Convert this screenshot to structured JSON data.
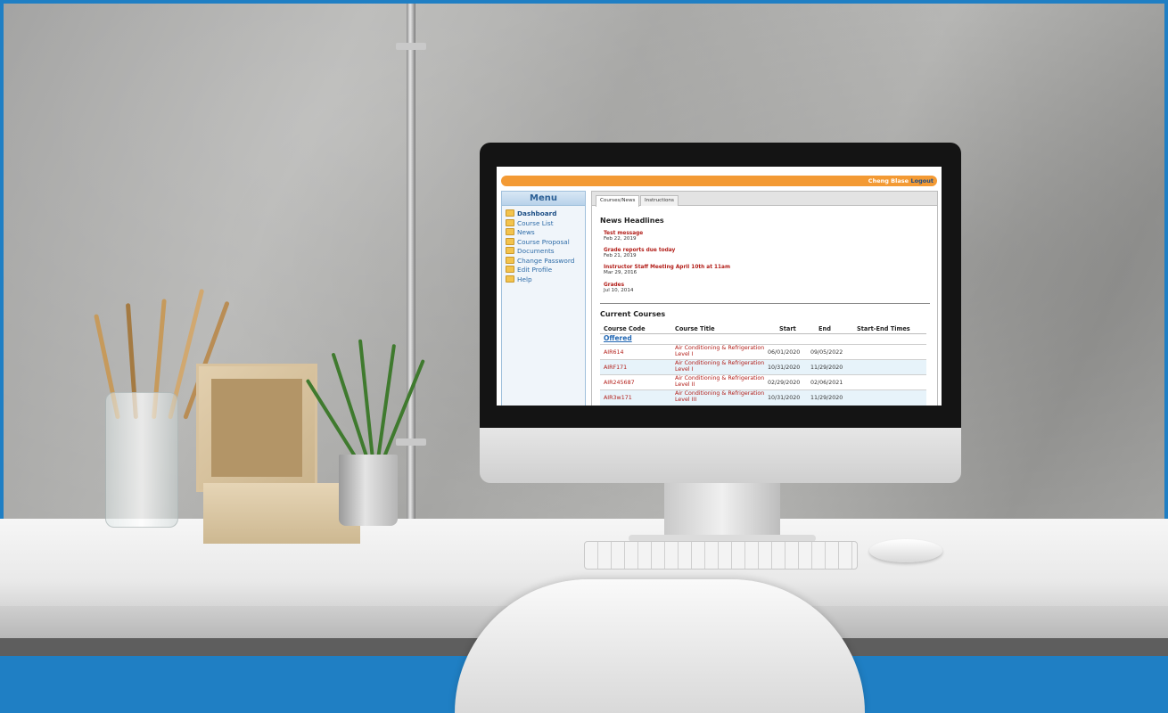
{
  "app": {
    "user_name": "Cheng Blase",
    "logout_label": "Logout"
  },
  "menu": {
    "title": "Menu",
    "items": [
      {
        "label": "Dashboard",
        "active": true
      },
      {
        "label": "Course List"
      },
      {
        "label": "News"
      },
      {
        "label": "Course Proposal"
      },
      {
        "label": "Documents"
      },
      {
        "label": "Change Password"
      },
      {
        "label": "Edit Profile"
      },
      {
        "label": "Help"
      }
    ]
  },
  "tabs": [
    {
      "label": "Courses/News",
      "active": true
    },
    {
      "label": "Instructions"
    }
  ],
  "news": {
    "heading": "News Headlines",
    "items": [
      {
        "title": "Test message",
        "date": "Feb 22, 2019"
      },
      {
        "title": "Grade reports due today",
        "date": "Feb 21, 2019"
      },
      {
        "title": "Instructor Staff Meeting April 10th at 11am",
        "date": "Mar 29, 2016"
      },
      {
        "title": "Grades",
        "date": "Jul 10, 2014"
      }
    ]
  },
  "courses": {
    "heading": "Current Courses",
    "columns": [
      "Course Code",
      "Course Title",
      "Start",
      "End",
      "Start-End Times"
    ],
    "group_label": "Offered",
    "rows": [
      {
        "code": "AIR614",
        "title": "Air Conditioning & Refrigeration Level I",
        "start": "06/01/2020",
        "end": "09/05/2022"
      },
      {
        "code": "AIRF171",
        "title": "Air Conditioning & Refrigeration Level I",
        "start": "10/31/2020",
        "end": "11/29/2020"
      },
      {
        "code": "AIR245687",
        "title": "Air Conditioning & Refrigeration Level II",
        "start": "02/29/2020",
        "end": "02/06/2021"
      },
      {
        "code": "AIR3w171",
        "title": "Air Conditioning & Refrigeration Level III",
        "start": "10/31/2020",
        "end": "11/29/2020"
      }
    ]
  },
  "colors": {
    "top_bar": "#f39a34",
    "link_red": "#b3201b",
    "menu_blue": "#2e6ca8",
    "frame_blue": "#1f7fc4"
  }
}
